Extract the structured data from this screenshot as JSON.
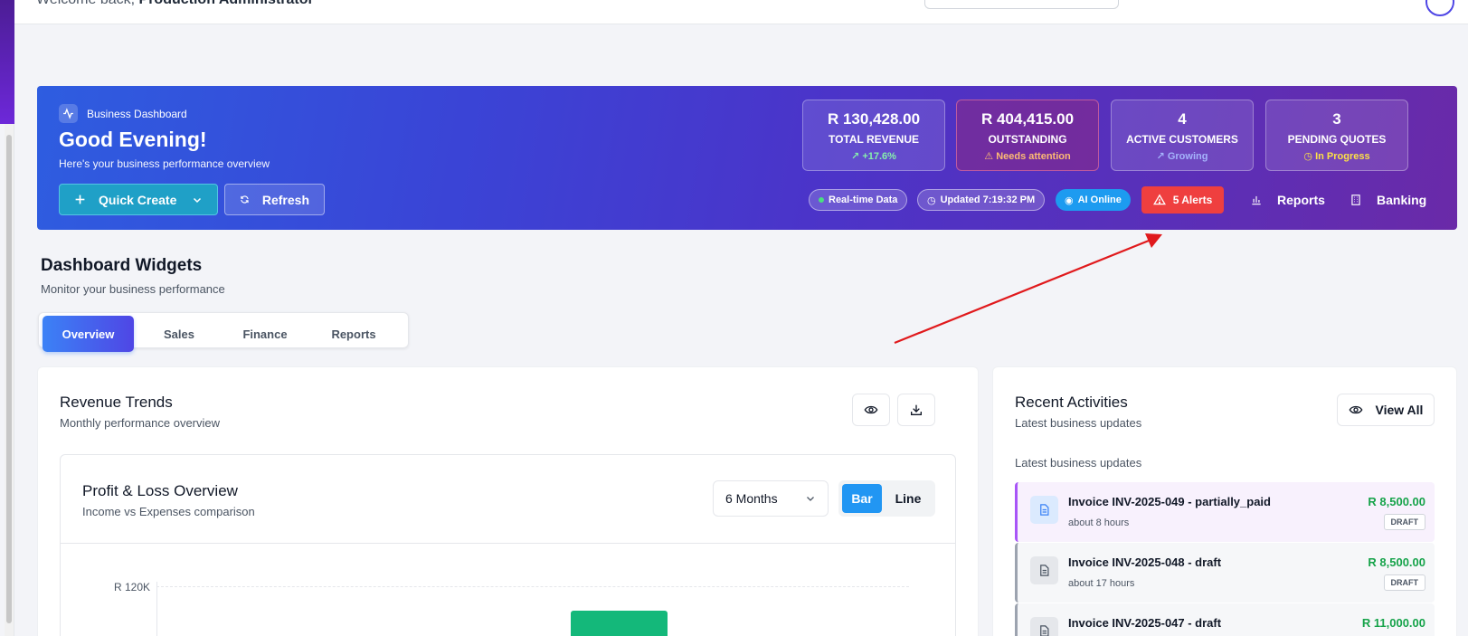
{
  "topbar": {
    "welcome_prefix": "Welcome back, ",
    "user_name": "Production Administrator"
  },
  "hero": {
    "badge": "Business Dashboard",
    "greeting": "Good Evening!",
    "subtitle": "Here's your business performance overview",
    "quick_create": "Quick Create",
    "refresh": "Refresh",
    "stats": [
      {
        "value": "R 130,428.00",
        "label": "TOTAL REVENUE",
        "trend": "+17.6%",
        "trend_color": "#86efac"
      },
      {
        "value": "R 404,415.00",
        "label": "OUTSTANDING",
        "trend": "Needs attention",
        "trend_color": "#fdba74"
      },
      {
        "value": "4",
        "label": "ACTIVE CUSTOMERS",
        "trend": "Growing",
        "trend_color": "#a5b4fc"
      },
      {
        "value": "3",
        "label": "PENDING QUOTES",
        "trend": "In Progress",
        "trend_color": "#fde047"
      }
    ],
    "pills": {
      "realtime": "Real-time Data",
      "updated": "Updated 7:19:32 PM",
      "ai": "AI Online"
    },
    "alerts": "5 Alerts",
    "reports": "Reports",
    "banking": "Banking"
  },
  "widgets": {
    "title": "Dashboard Widgets",
    "subtitle": "Monitor your business performance",
    "tabs": [
      "Overview",
      "Sales",
      "Finance",
      "Reports"
    ],
    "active_tab": "Overview"
  },
  "revenue": {
    "title": "Revenue Trends",
    "subtitle": "Monthly performance overview",
    "pl_title": "Profit & Loss Overview",
    "pl_subtitle": "Income vs Expenses comparison",
    "period": "6 Months",
    "mode_bar": "Bar",
    "mode_line": "Line",
    "y_tick": "R 120K"
  },
  "activities": {
    "title": "Recent Activities",
    "subtitle": "Latest business updates",
    "view_all": "View All",
    "section": "Latest business updates",
    "items": [
      {
        "name": "Invoice INV-2025-049 - partially_paid",
        "time": "about 8 hours",
        "amount": "R 8,500.00",
        "status": "DRAFT"
      },
      {
        "name": "Invoice INV-2025-048 - draft",
        "time": "about 17 hours",
        "amount": "R 8,500.00",
        "status": "DRAFT"
      },
      {
        "name": "Invoice INV-2025-047 - draft",
        "time": "",
        "amount": "R 11,000.00",
        "status": ""
      }
    ]
  },
  "colors": {
    "accent_blue": "#3b82f6",
    "alert_red": "#ef3f3f",
    "positive_green": "#16a34a",
    "bar_green": "#14b87a",
    "annotation_red": "#e0191c"
  }
}
